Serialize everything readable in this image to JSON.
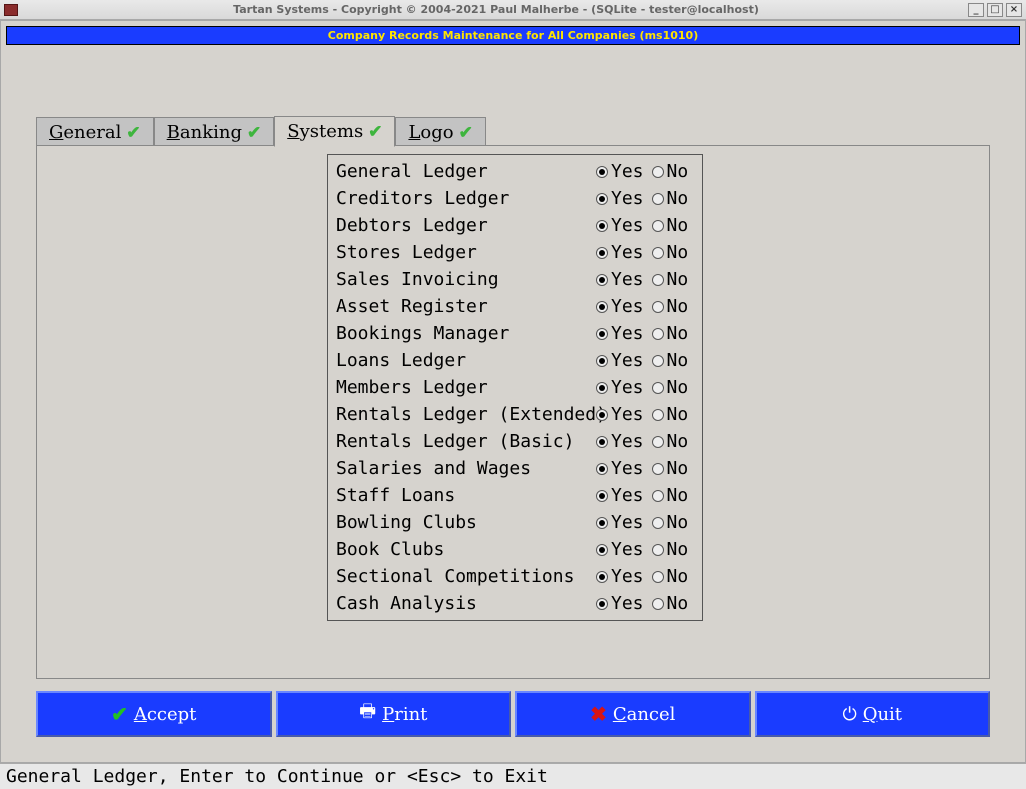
{
  "window": {
    "title": "Tartan Systems - Copyright © 2004-2021 Paul Malherbe - (SQLite - tester@localhost)",
    "subtitle": "Company Records Maintenance for All Companies (ms1010)"
  },
  "tabs": [
    {
      "label": "General",
      "u": "G",
      "rest": "eneral"
    },
    {
      "label": "Banking",
      "u": "B",
      "rest": "anking"
    },
    {
      "label": "Systems",
      "u": "S",
      "rest": "ystems"
    },
    {
      "label": "Logo",
      "u": "L",
      "rest": "ogo"
    }
  ],
  "active_tab": "Systems",
  "options": {
    "yes": "Yes",
    "no": "No"
  },
  "systems": [
    {
      "label": "General Ledger",
      "value": "Yes"
    },
    {
      "label": "Creditors Ledger",
      "value": "Yes"
    },
    {
      "label": "Debtors Ledger",
      "value": "Yes"
    },
    {
      "label": "Stores Ledger",
      "value": "Yes"
    },
    {
      "label": "Sales Invoicing",
      "value": "Yes"
    },
    {
      "label": "Asset Register",
      "value": "Yes"
    },
    {
      "label": "Bookings Manager",
      "value": "Yes"
    },
    {
      "label": "Loans Ledger",
      "value": "Yes"
    },
    {
      "label": "Members Ledger",
      "value": "Yes"
    },
    {
      "label": "Rentals Ledger (Extended)",
      "value": "Yes"
    },
    {
      "label": "Rentals Ledger (Basic)",
      "value": "Yes"
    },
    {
      "label": "Salaries and Wages",
      "value": "Yes"
    },
    {
      "label": "Staff Loans",
      "value": "Yes"
    },
    {
      "label": "Bowling Clubs",
      "value": "Yes"
    },
    {
      "label": "Book Clubs",
      "value": "Yes"
    },
    {
      "label": "Sectional Competitions",
      "value": "Yes"
    },
    {
      "label": "Cash Analysis",
      "value": "Yes"
    }
  ],
  "buttons": {
    "accept": {
      "label": "ccept",
      "u": "A"
    },
    "print": {
      "label": "rint",
      "u": "P"
    },
    "cancel": {
      "label": "ancel",
      "u": "C"
    },
    "quit": {
      "label": "uit",
      "u": "Q"
    }
  },
  "status": "General Ledger, Enter to Continue or <Esc> to Exit"
}
